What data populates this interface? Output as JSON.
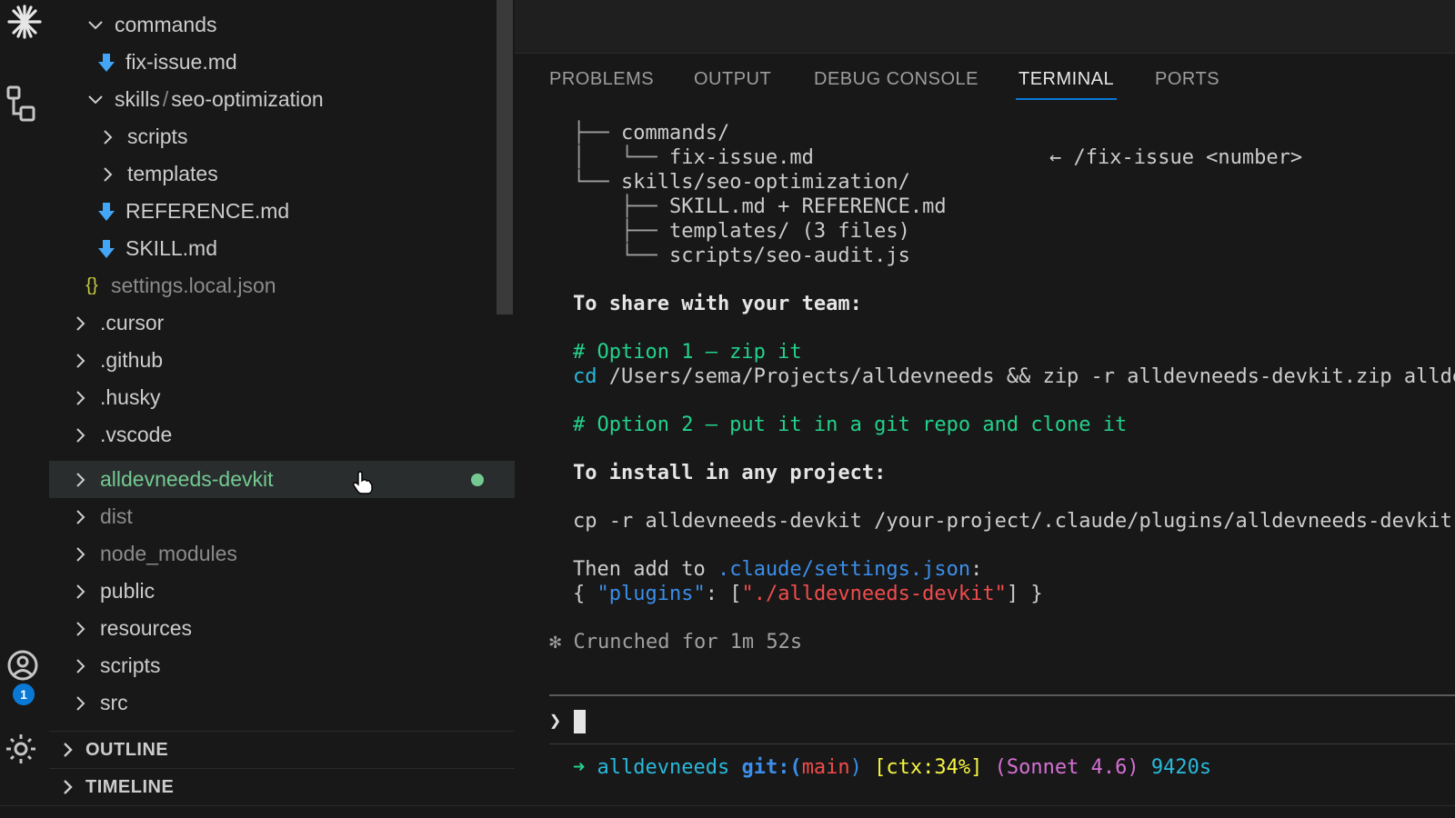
{
  "explorer": {
    "items": [
      {
        "name": "commands",
        "type": "folder",
        "expanded": true
      },
      {
        "name": "fix-issue.md",
        "type": "markdown"
      },
      {
        "name": "skills",
        "sep": "/",
        "name2": "seo-optimization",
        "type": "folder",
        "expanded": true
      },
      {
        "name": "scripts",
        "type": "folder",
        "expanded": false
      },
      {
        "name": "templates",
        "type": "folder",
        "expanded": false
      },
      {
        "name": "REFERENCE.md",
        "type": "markdown"
      },
      {
        "name": "SKILL.md",
        "type": "markdown"
      },
      {
        "name": "settings.local.json",
        "type": "json",
        "icon": "{}"
      },
      {
        "name": ".cursor",
        "type": "folder"
      },
      {
        "name": ".github",
        "type": "folder"
      },
      {
        "name": ".husky",
        "type": "folder"
      },
      {
        "name": ".vscode",
        "type": "folder"
      },
      {
        "name": "alldevneeds-devkit",
        "type": "folder",
        "selected": true
      },
      {
        "name": "dist",
        "type": "folder"
      },
      {
        "name": "node_modules",
        "type": "folder"
      },
      {
        "name": "public",
        "type": "folder"
      },
      {
        "name": "resources",
        "type": "folder"
      },
      {
        "name": "scripts",
        "type": "folder"
      },
      {
        "name": "src",
        "type": "folder"
      }
    ],
    "sections": {
      "outline": "OUTLINE",
      "timeline": "TIMELINE"
    }
  },
  "activity": {
    "badge_count": "1"
  },
  "panel": {
    "tabs": {
      "problems": "PROBLEMS",
      "output": "OUTPUT",
      "debug_console": "DEBUG CONSOLE",
      "terminal": "TERMINAL",
      "ports": "PORTS"
    },
    "active_tab": "TERMINAL"
  },
  "terminal": {
    "tree": {
      "l1_prefix": "├── ",
      "l1_text": "commands/",
      "l2_prefix": "│   └── ",
      "l2_text": "fix-issue.md",
      "l2_hint": "← /fix-issue <number>",
      "l3_prefix": "└── ",
      "l3_text": "skills/seo-optimization/",
      "l4_prefix": "    ├── ",
      "l4_text": "SKILL.md + REFERENCE.md",
      "l5_prefix": "    ├── ",
      "l5_text": "templates/ (3 files)",
      "l6_prefix": "    └── ",
      "l6_text": "scripts/seo-audit.js"
    },
    "share_heading": "To share with your team:",
    "opt1_comment": "# Option 1 — zip it",
    "opt1_cmd": "cd",
    "opt1_rest": " /Users/sema/Projects/alldevneeds && zip -r alldevneeds-devkit.zip allde",
    "opt2_comment": "# Option 2 — put it in a git repo and clone it",
    "install_heading": "To install in any project:",
    "install_cmd": "cp -r alldevneeds-devkit /your-project/.claude/plugins/alldevneeds-devkit",
    "then_prefix": "Then add to ",
    "then_path": ".claude/settings.json",
    "then_suffix": ":",
    "json_open": "{ ",
    "json_key": "\"plugins\"",
    "json_colon": ": [",
    "json_value": "\"./alldevneeds-devkit\"",
    "json_close": "] }",
    "status_star": "✻",
    "status_text": "Crunched for 1m 52s",
    "prompt_symbol": "❯",
    "prompt": {
      "arrow": "➜",
      "dir": "alldevneeds",
      "git_label": "git:(",
      "branch": "main",
      "git_close": ")",
      "ctx": "[ctx:34%]",
      "model": "(Sonnet 4.6)",
      "time": "9420s"
    }
  }
}
